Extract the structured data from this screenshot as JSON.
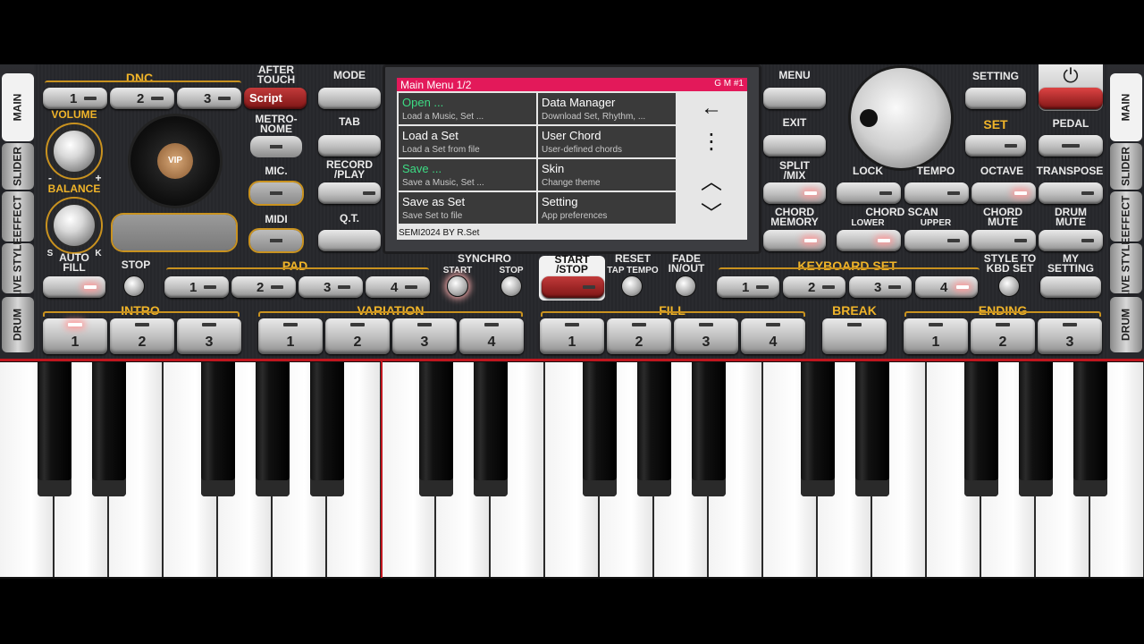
{
  "side_tabs_left": [
    "MAIN",
    "SLIDER",
    "EFFECT",
    "LIVE\nSTYLE",
    "DRUM"
  ],
  "side_tabs_right": [
    "MAIN",
    "SLIDER",
    "EFFECT",
    "LIVE\nSTYLE",
    "DRUM"
  ],
  "dnc": {
    "title": "DNC",
    "buttons": [
      "1",
      "2",
      "3"
    ],
    "script_label": "Script"
  },
  "labels": {
    "after_touch": "AFTER\nTOUCH",
    "volume": "VOLUME",
    "balance": "BALANCE",
    "metronome": "METRO-\nNOME",
    "mic": "MIC.",
    "midi": "MIDI",
    "mode": "MODE",
    "tab": "TAB",
    "record_play": "RECORD\n/PLAY",
    "qt": "Q.T.",
    "menu": "MENU",
    "exit": "EXIT",
    "split_mix": "SPLIT\n/MIX",
    "chord_memory": "CHORD\nMEMORY",
    "setting": "SETTING",
    "set": "SET",
    "pedal": "PEDAL",
    "lock": "LOCK",
    "tempo": "TEMPO",
    "octave": "OCTAVE",
    "transpose": "TRANSPOSE",
    "chord_scan": "CHORD SCAN",
    "lower": "LOWER",
    "upper": "UPPER",
    "chord_mute": "CHORD\nMUTE",
    "drum_mute": "DRUM\nMUTE",
    "auto_fill": "AUTO\nFILL",
    "stop": "STOP",
    "pad": "PAD",
    "synchro": "SYNCHRO",
    "synchro_start": "START",
    "synchro_stop": "STOP",
    "start_stop": "START\n/STOP",
    "reset": "RESET",
    "tap_tempo": "TAP TEMPO",
    "fade": "FADE\nIN/OUT",
    "keyboard_set": "KEYBOARD SET",
    "style_to_kbd": "STYLE TO\nKBD SET",
    "my_setting": "MY\nSETTING",
    "intro": "INTRO",
    "variation": "VARIATION",
    "fill": "FILL",
    "break": "BREAK",
    "ending": "ENDING",
    "plus": "+",
    "minus": "-",
    "s": "S",
    "k": "K",
    "vip": "VIP"
  },
  "pad_buttons": [
    "1",
    "2",
    "3",
    "4"
  ],
  "keyboard_set_buttons": [
    "1",
    "2",
    "3",
    "4"
  ],
  "intro_buttons": [
    "1",
    "2",
    "3"
  ],
  "variation_buttons": [
    "1",
    "2",
    "3",
    "4"
  ],
  "fill_buttons": [
    "1",
    "2",
    "3",
    "4"
  ],
  "ending_buttons": [
    "1",
    "2",
    "3"
  ],
  "screen": {
    "header_title": "Main Menu  1/2",
    "header_right": "G M #1",
    "items": [
      {
        "main": "Open ...",
        "sub": "Load a Music, Set ..."
      },
      {
        "main": "Data Manager",
        "sub": "Download Set, Rhythm, ..."
      },
      {
        "main": "Load a Set",
        "sub": "Load a Set from file"
      },
      {
        "main": "User Chord",
        "sub": "User-defined chords"
      },
      {
        "main": "Save ...",
        "sub": "Save a Music, Set ..."
      },
      {
        "main": "Skin",
        "sub": "Change theme"
      },
      {
        "main": "Save as Set",
        "sub": "Save Set to file"
      },
      {
        "main": "Setting",
        "sub": "App preferences"
      }
    ],
    "footer": "SEMI2024 BY R.Set",
    "nav": {
      "back": "←",
      "more": "⋮",
      "up": "︿",
      "down": "﹀"
    }
  },
  "power_icon": "⏻",
  "colors": {
    "accent_gold": "#f0b429",
    "screen_header": "#e3195a",
    "highlight_green": "#3ddc84",
    "keyboard_marker": "#c0161e"
  }
}
